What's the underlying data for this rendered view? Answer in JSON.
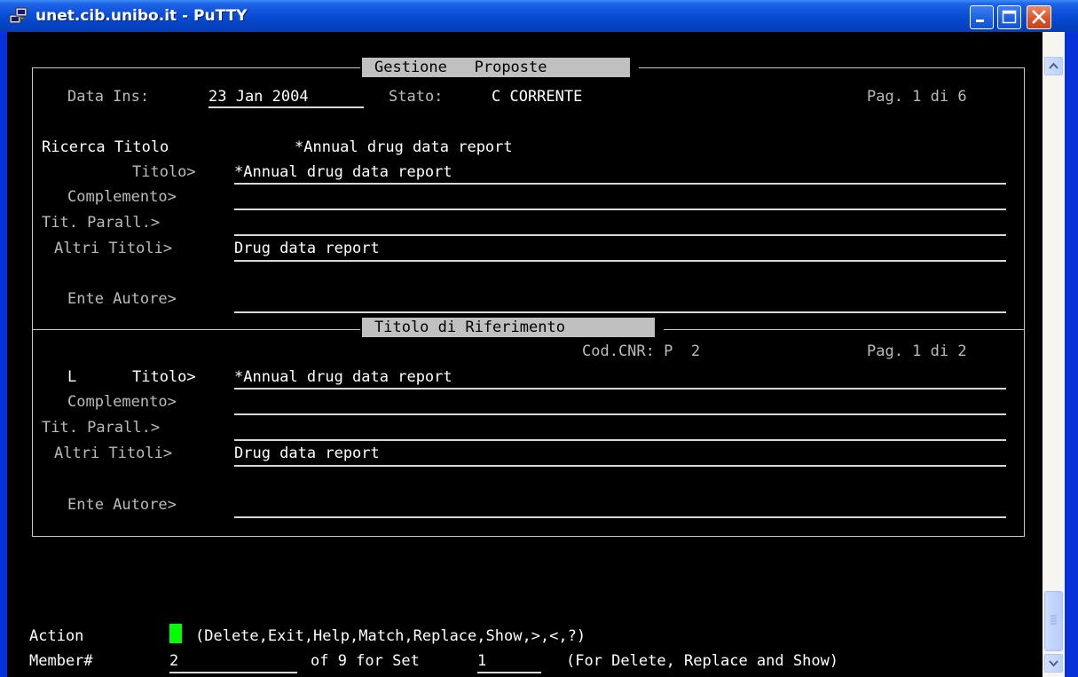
{
  "window": {
    "title": "unet.cib.unibo.it - PuTTY"
  },
  "form": {
    "section1_title_a": "Gestione",
    "section1_title_b": "Proposte",
    "data_ins_label": "Data Ins:",
    "data_ins_value": "23 Jan 2004",
    "stato_label": "Stato:",
    "stato_value": "C CORRENTE",
    "page1": "Pag. 1 di 6",
    "ricerca_label": "Ricerca Titolo",
    "ricerca_value": "*Annual drug data report",
    "fields1": [
      {
        "label": "Titolo>",
        "value": "*Annual drug data report"
      },
      {
        "label": "Complemento>",
        "value": ""
      },
      {
        "label": "Tit. Parall.>",
        "value": ""
      },
      {
        "label": "Altri Titoli>",
        "value": "Drug data report"
      }
    ],
    "ente_label": "Ente Autore>",
    "ente_value1": "",
    "section2_title": "Titolo di Riferimento",
    "codcnr": "Cod.CNR: P  2",
    "page2": "Pag. 1 di 2",
    "l_marker": "L",
    "fields2": [
      {
        "label": "Titolo>",
        "value": "*Annual drug data report"
      },
      {
        "label": "Complemento>",
        "value": ""
      },
      {
        "label": "Tit. Parall.>",
        "value": ""
      },
      {
        "label": "Altri Titoli>",
        "value": "Drug data report"
      }
    ],
    "ente_value2": ""
  },
  "commandline": {
    "action_label": "Action",
    "action_options": "(Delete,Exit,Help,Match,Replace,Show,>,<,?)",
    "member_label": "Member#",
    "member_value": "2",
    "of_text": "of 9 for Set",
    "set_value": "1",
    "hint": "(For Delete, Replace and Show)"
  },
  "colors": {
    "cursor": "#00ff00",
    "terminal_bg": "#000000",
    "titlebar": "#0a4fd8"
  }
}
